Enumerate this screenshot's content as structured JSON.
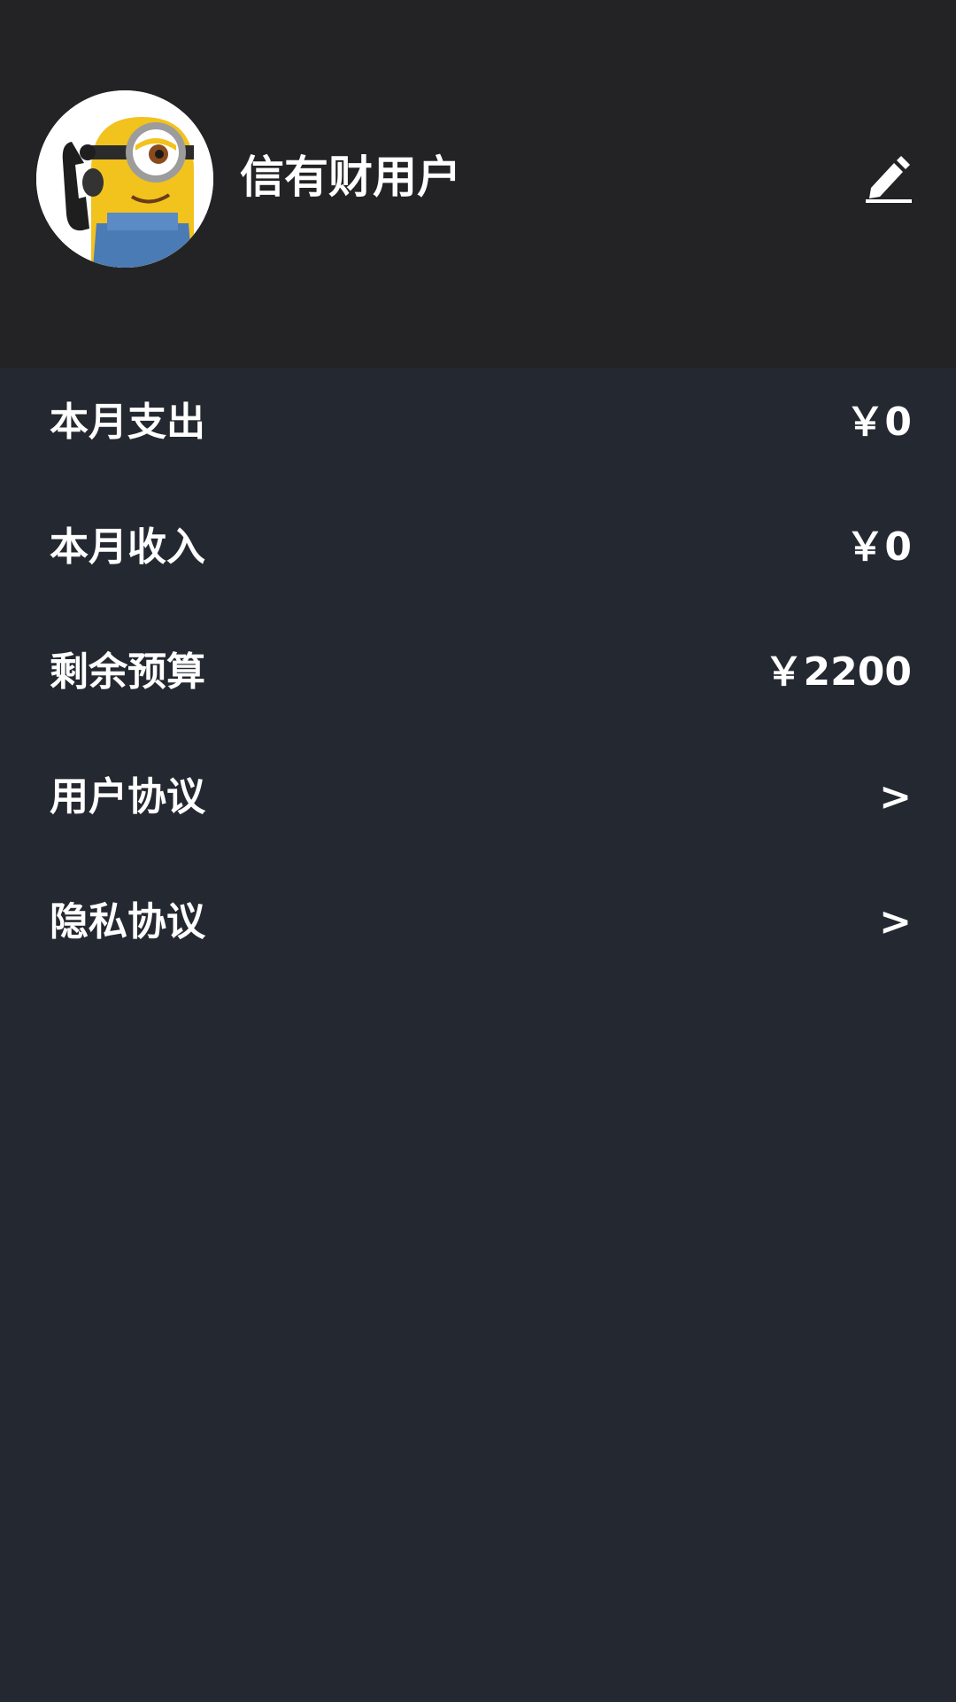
{
  "profile": {
    "username": "信有财用户",
    "avatar": "minion-avatar",
    "edit_icon": "edit-pencil-icon"
  },
  "stats": [
    {
      "label": "本月支出",
      "value": "￥0"
    },
    {
      "label": "本月收入",
      "value": "￥0"
    },
    {
      "label": "剩余预算",
      "value": "￥2200"
    }
  ],
  "links": [
    {
      "label": "用户协议",
      "arrow": ">"
    },
    {
      "label": "隐私协议",
      "arrow": ">"
    }
  ],
  "colors": {
    "header_bg": "#232325",
    "body_bg": "#242830",
    "text": "#ffffff"
  }
}
